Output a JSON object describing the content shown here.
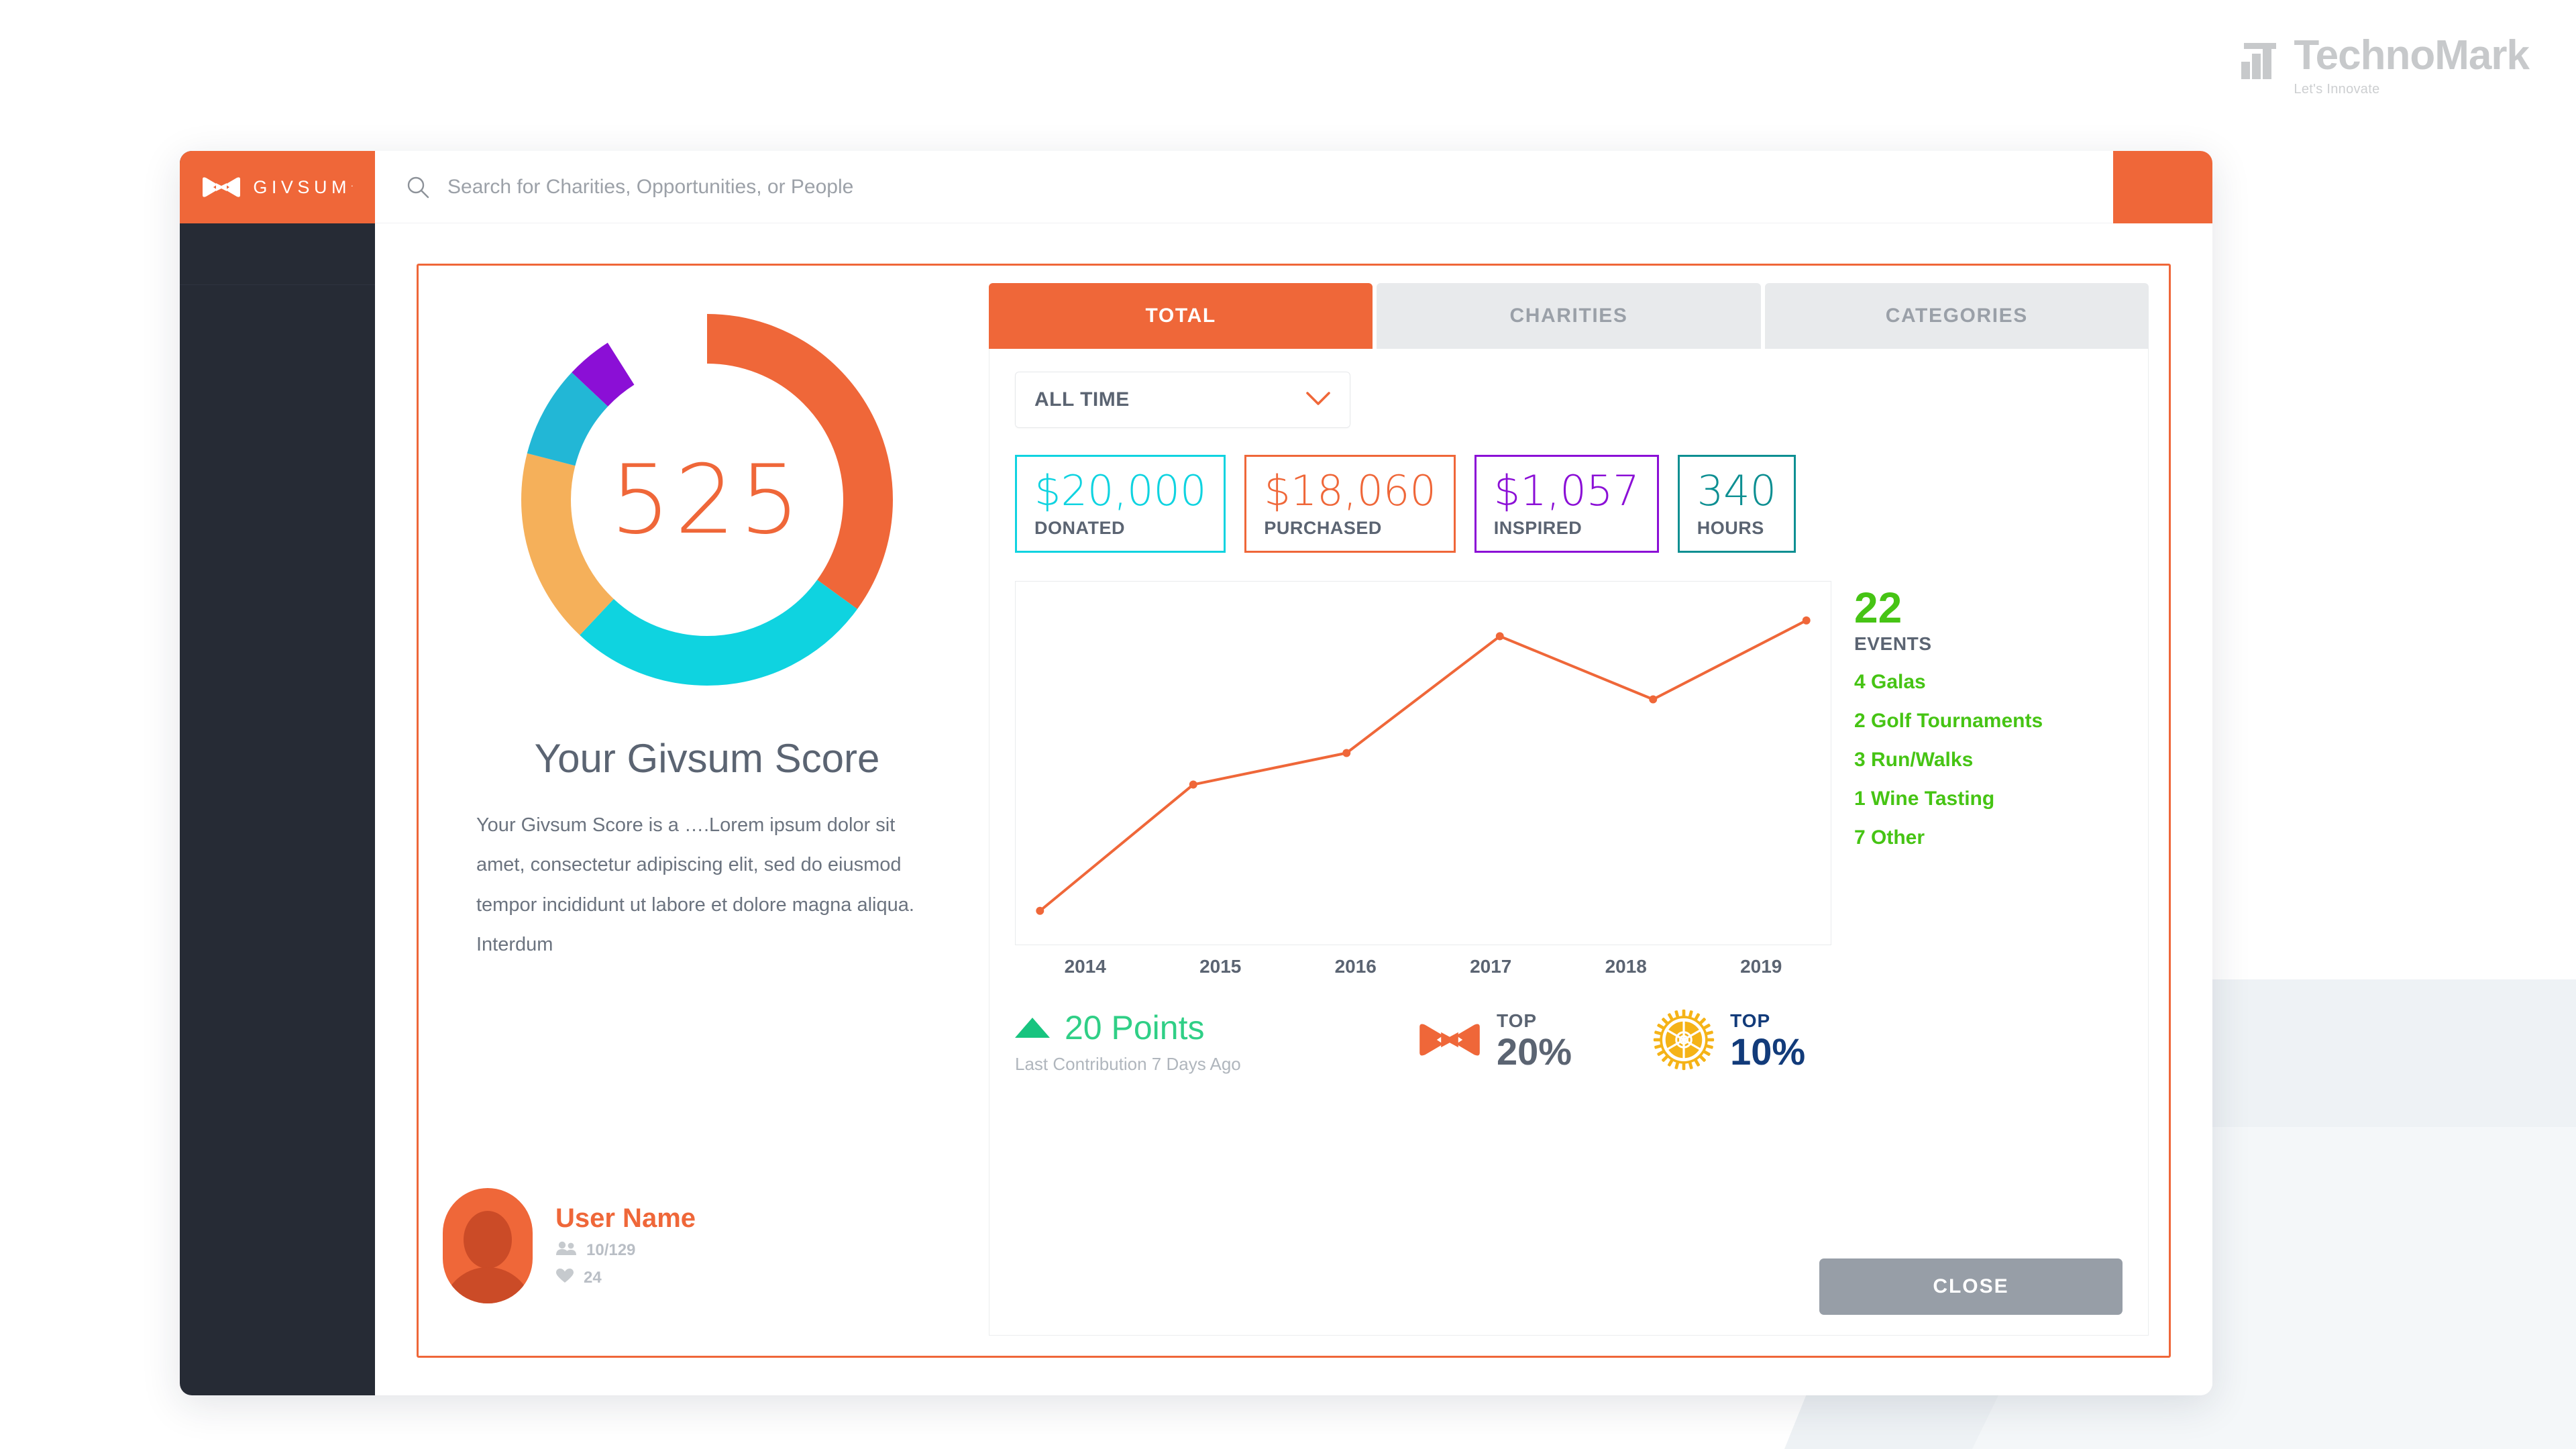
{
  "brand_watermark": {
    "name": "TechnoMark",
    "tagline": "Let's Innovate",
    "icon": "bar-chart-t-logo-icon",
    "color": "#c7c9cb"
  },
  "app": {
    "sidebar": {
      "brand_name": "GIVSUM",
      "brand_tm": ".",
      "brand_icon": "givsum-bowtie-icon",
      "bg_color": "#262b35",
      "brand_bg_color": "#ef6739"
    },
    "topbar": {
      "search_icon": "search-icon",
      "search_value": "",
      "search_placeholder": "Search for Charities, Opportunities, or People",
      "action_block_color": "#ef6739"
    }
  },
  "modal": {
    "border_color": "#ef6739",
    "tabs": [
      {
        "label": "TOTAL",
        "active": true
      },
      {
        "label": "CHARITIES",
        "active": false
      },
      {
        "label": "CATEGORIES",
        "active": false
      }
    ],
    "period_select": {
      "value": "ALL TIME",
      "chevron_icon": "chevron-down-icon",
      "chevron_color": "#ef6739"
    },
    "stats": [
      {
        "value": "$20,000",
        "label": "DONATED",
        "color": "#0fd3e0"
      },
      {
        "value": "$18,060",
        "label": "PURCHASED",
        "color": "#ef6739"
      },
      {
        "value": "$1,057",
        "label": "INSPIRED",
        "color": "#8b0fd6"
      },
      {
        "value": "340",
        "label": "HOURS",
        "color": "#0d8f92"
      }
    ],
    "score": {
      "value": "525",
      "title": "Your Givsum Score",
      "description": "Your Givsum Score is a ….Lorem ipsum dolor sit amet, consectetur adipiscing elit, sed do eiusmod tempor incididunt ut labore et dolore magna aliqua. Interdum"
    },
    "user": {
      "avatar_icon": "avatar",
      "name": "User Name",
      "followers_icon": "people-icon",
      "followers": "10/129",
      "likes_icon": "heart-icon",
      "likes": "24"
    },
    "events": {
      "count": "22",
      "label": "EVENTS",
      "color": "#46c414",
      "items": [
        "4 Galas",
        "2 Golf Tournaments",
        "3 Run/Walks",
        "1 Wine Tasting",
        "7 Other"
      ]
    },
    "points": {
      "trend_icon": "triangle-up-icon",
      "value": "20 Points",
      "subtitle": "Last Contribution 7 Days Ago",
      "color": "#2fcf86"
    },
    "badges": [
      {
        "icon": "givsum-bowtie-icon",
        "icon_color": "#ef6739",
        "top_label": "TOP",
        "percent": "20%",
        "text_color": "#5b6472"
      },
      {
        "icon": "rotary-international-icon",
        "icon_color": "#f5b317",
        "top_label": "TOP",
        "percent": "10%",
        "text_color": "#123b7a"
      }
    ],
    "close_label": "CLOSE"
  },
  "chart_data": [
    {
      "type": "pie",
      "title": "Givsum Score Breakdown",
      "center_label": "525",
      "legend": "none",
      "labels": [
        "Donated",
        "Purchased",
        "Hours",
        "Inspired",
        "Other"
      ],
      "values": [
        35,
        27,
        17,
        8,
        4
      ],
      "colors": [
        "#ef6739",
        "#0fd3e0",
        "#f5b05a",
        "#22b7d6",
        "#8b0fd6"
      ]
    },
    {
      "type": "line",
      "title": "",
      "xlabel": "",
      "ylabel": "",
      "grid": false,
      "legend": "none",
      "line_color": "#ef6739",
      "categories": [
        "2014",
        "2015",
        "2016",
        "2017",
        "2018",
        "2019"
      ],
      "values": [
        5,
        45,
        55,
        92,
        72,
        97
      ],
      "ylim": [
        0,
        100
      ]
    }
  ]
}
